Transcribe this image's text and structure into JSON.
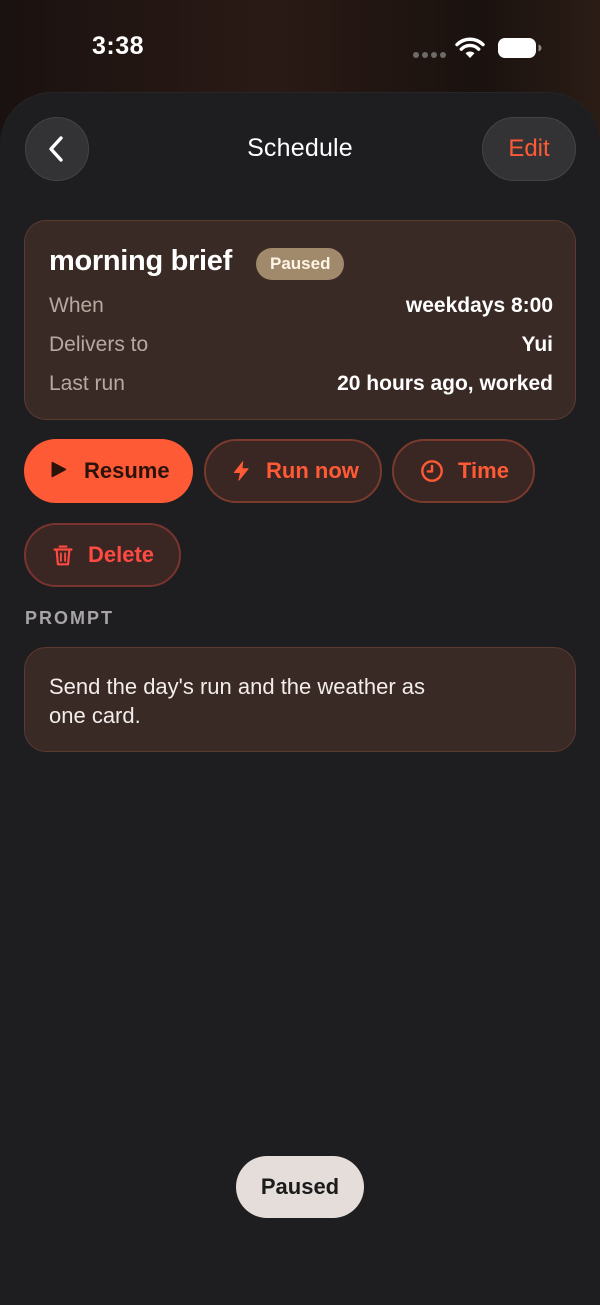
{
  "status_bar": {
    "time": "3:38",
    "icons": [
      "signal-dots-icon",
      "wifi-icon",
      "battery-icon"
    ]
  },
  "nav": {
    "back_icon": "chevron-left-icon",
    "title": "Schedule",
    "edit_label": "Edit"
  },
  "schedule": {
    "name": "morning brief",
    "status": "Paused",
    "rows": [
      {
        "key": "When",
        "value": "weekdays 8:00"
      },
      {
        "key": "Delivers to",
        "value": "Yui"
      },
      {
        "key": "Last run",
        "value": "20 hours ago, worked"
      }
    ]
  },
  "actions": {
    "resume": {
      "label": "Resume",
      "icon": "play-icon"
    },
    "run_now": {
      "label": "Run now",
      "icon": "lightning-icon"
    },
    "time": {
      "label": "Time",
      "icon": "clock-icon"
    },
    "delete": {
      "label": "Delete",
      "icon": "trash-icon"
    }
  },
  "prompt": {
    "label": "PROMPT",
    "text": "Send the day's run and the weather as one card."
  },
  "toast": {
    "text": "Paused"
  },
  "colors": {
    "accent": "#ff5a36",
    "danger": "#ff4a42",
    "card_bg": "#3a2a25",
    "sheet_bg": "#1e1e20",
    "badge_bg": "#a08a6b"
  }
}
